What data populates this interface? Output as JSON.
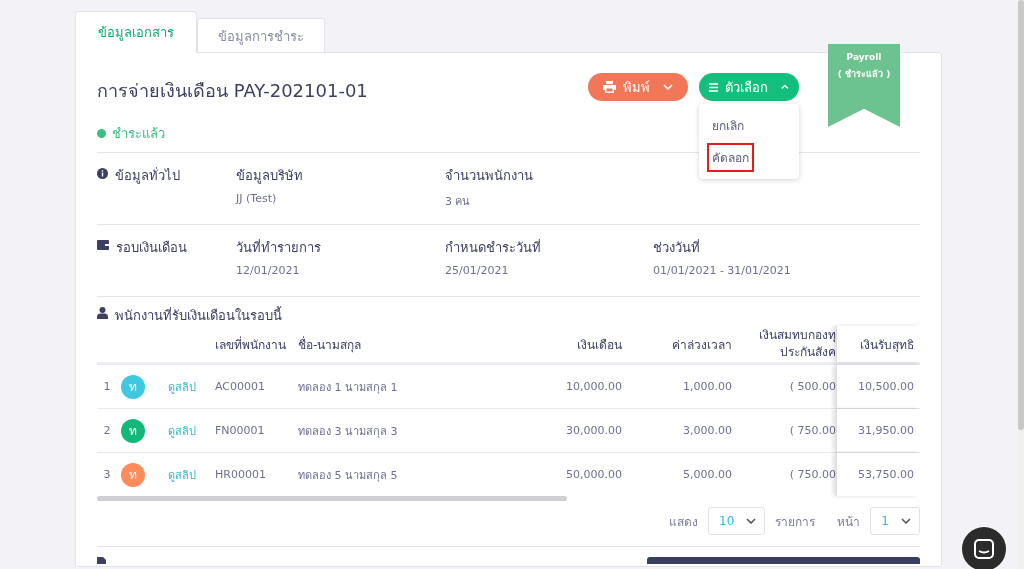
{
  "tabs": [
    {
      "label": "ข้อมูลเอกสาร",
      "selected": true
    },
    {
      "label": "ข้อมูลการชำระ",
      "selected": false
    }
  ],
  "document": {
    "title": "การจ่ายเงินเดือน PAY-202101-01",
    "status": "ชำระแล้ว"
  },
  "actions": [
    {
      "kind": "print",
      "label": "พิมพ์",
      "expanded": false
    },
    {
      "kind": "options",
      "label": "ตัวเลือก",
      "expanded": true
    }
  ],
  "options_menu": [
    {
      "label": "ยกเลิก",
      "highlighted": false
    },
    {
      "label": "คัดลอก",
      "highlighted": true
    }
  ],
  "ribbon": {
    "title": "Payroll",
    "subtitle": "( ชำระแล้ว )"
  },
  "sections": [
    {
      "kind": "info",
      "title": "ข้อมูลทั่วไป",
      "fields": [
        {
          "label": "ข้อมูลบริษัท",
          "value": "JJ (Test)"
        },
        {
          "label": "จำนวนพนักงาน",
          "value": "3 คน"
        }
      ]
    },
    {
      "kind": "wallet",
      "title": "รอบเงินเดือน",
      "fields": [
        {
          "label": "วันที่ทำรายการ",
          "value": "12/01/2021"
        },
        {
          "label": "กำหนดชำระวันที่",
          "value": "25/01/2021"
        },
        {
          "label": "ช่วงวันที่",
          "value": "01/01/2021 - 31/01/2021"
        }
      ]
    }
  ],
  "employees": {
    "title": "พนักงานที่รับเงินเดือนในรอบนี้",
    "columns": [
      "เลขที่พนักงาน",
      "ชื่อ-นามสกุล",
      "เงินเดือน",
      "ค่าล่วงเวลา",
      "เงินสมทบกองทุ\nประกันสังค",
      "เงินรับสุทธิ"
    ],
    "rows": [
      {
        "no": "1",
        "avatar": "ท",
        "color": "#40c8e0",
        "slip": "ดูสลิป",
        "id": "AC00001",
        "name": "ทดลอง 1 นามสกุล 1",
        "salary": "10,000.00",
        "overtime": "1,000.00",
        "contribution": "( 500.00",
        "net": "10,500.00"
      },
      {
        "no": "2",
        "avatar": "ท",
        "color": "#14b97a",
        "slip": "ดูสลิป",
        "id": "FN00001",
        "name": "ทดลอง 3 นามสกุล 3",
        "salary": "30,000.00",
        "overtime": "3,000.00",
        "contribution": "( 750.00",
        "net": "31,950.00"
      },
      {
        "no": "3",
        "avatar": "ท",
        "color": "#fd8c5c",
        "slip": "ดูสลิป",
        "id": "HR00001",
        "name": "ทดลอง 5 นามสกุล 5",
        "salary": "50,000.00",
        "overtime": "5,000.00",
        "contribution": "( 750.00",
        "net": "53,750.00"
      }
    ]
  },
  "pager": {
    "show_label": "แสดง",
    "page_size": "10",
    "unit": "รายการ",
    "page_label": "หน้า",
    "page": "1"
  }
}
